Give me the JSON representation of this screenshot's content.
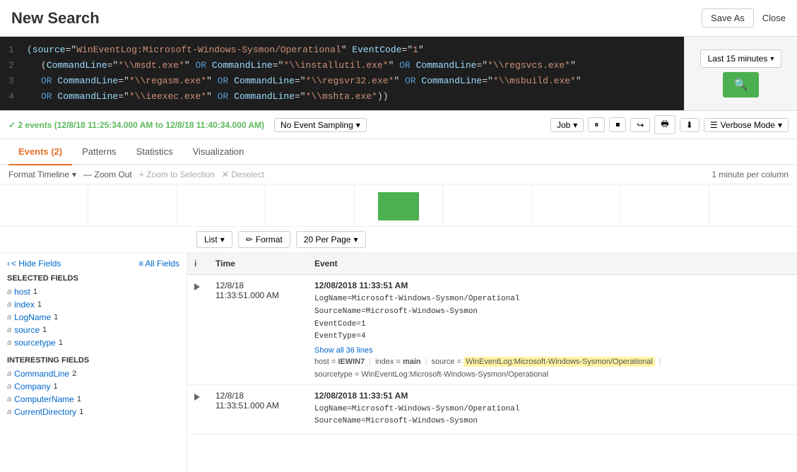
{
  "header": {
    "title": "New Search",
    "save_as_label": "Save As",
    "close_label": "Close"
  },
  "search": {
    "code_lines": [
      {
        "num": "1",
        "content": "(source=\"WinEventLog:Microsoft-Windows-Sysmon/Operational\" EventCode=\"1\""
      },
      {
        "num": "2",
        "content": "    (CommandLine=\"*\\\\msdt.exe*\" OR CommandLine=\"*\\\\installutil.exe*\" OR CommandLine=\"*\\\\regsvcs.exe*\""
      },
      {
        "num": "3",
        "content": "    OR CommandLine=\"*\\\\regasm.exe*\" OR CommandLine=\"*\\\\regsvr32.exe*\" OR CommandLine=\"*\\\\msbuild.exe*\""
      },
      {
        "num": "4",
        "content": "    OR CommandLine=\"*\\\\ieexec.exe*\" OR CommandLine=\"*\\\\mshta.exe*\"))"
      }
    ],
    "time_range": "Last 15 minutes"
  },
  "toolbar": {
    "result_count": "✓ 2 events (12/8/18 11:25:34.000 AM to 12/8/18 11:40:34.000 AM)",
    "sampling_label": "No Event Sampling",
    "job_label": "Job",
    "verbose_label": "Verbose Mode"
  },
  "tabs": [
    {
      "label": "Events (2)",
      "active": true
    },
    {
      "label": "Patterns",
      "active": false
    },
    {
      "label": "Statistics",
      "active": false
    },
    {
      "label": "Visualization",
      "active": false
    }
  ],
  "timeline": {
    "format_btn": "Format Timeline",
    "zoom_out_btn": "— Zoom Out",
    "zoom_selection_btn": "+ Zoom to Selection",
    "deselect_btn": "✕ Deselect",
    "per_column": "1 minute per column"
  },
  "results_toolbar": {
    "list_btn": "List",
    "format_btn": "Format",
    "per_page_btn": "20 Per Page"
  },
  "sidebar": {
    "hide_fields_btn": "< Hide Fields",
    "all_fields_btn": "≡ All Fields",
    "selected_section": "SELECTED FIELDS",
    "selected_fields": [
      {
        "type": "a",
        "name": "host",
        "count": "1"
      },
      {
        "type": "a",
        "name": "index",
        "count": "1"
      },
      {
        "type": "a",
        "name": "LogName",
        "count": "1"
      },
      {
        "type": "a",
        "name": "source",
        "count": "1"
      },
      {
        "type": "a",
        "name": "sourcetype",
        "count": "1"
      }
    ],
    "interesting_section": "INTERESTING FIELDS",
    "interesting_fields": [
      {
        "type": "a",
        "name": "CommandLine",
        "count": "2"
      },
      {
        "type": "a",
        "name": "Company",
        "count": "1"
      },
      {
        "type": "a",
        "name": "ComputerName",
        "count": "1"
      },
      {
        "type": "a",
        "name": "CurrentDirectory",
        "count": "1"
      }
    ]
  },
  "table": {
    "headers": [
      "",
      "Time",
      "Event"
    ],
    "rows": [
      {
        "time": "12/8/18\n11:33:51.000 AM",
        "timestamp": "12/08/2018 11:33:51 AM",
        "details": [
          "LogName=Microsoft-Windows-Sysmon/Operational",
          "SourceName=Microsoft-Windows-Sysmon",
          "EventCode=1",
          "EventType=4"
        ],
        "show_more": "Show all 36 lines",
        "tags": [
          {
            "label": "host =  IEWIN7",
            "highlighted": false
          },
          {
            "label": "index =  main",
            "highlighted": false
          },
          {
            "label": "source =  WinEventLog:Microsoft-Windows-Sysmon/Operational",
            "highlighted": true
          },
          {
            "label": "sourcetype =  WinEventLog:Microsoft-Windows-Sysmon/Operational",
            "highlighted": false
          }
        ]
      },
      {
        "time": "12/8/18\n11:33:51.000 AM",
        "timestamp": "12/08/2018 11:33:51 AM",
        "details": [
          "LogName=Microsoft-Windows-Sysmon/Operational",
          "SourceName=Microsoft-Windows-Sysmon"
        ],
        "show_more": "",
        "tags": []
      }
    ]
  },
  "colors": {
    "accent_orange": "#e8702a",
    "accent_green": "#4caf50",
    "link_blue": "#0066cc",
    "highlight_yellow": "#fff3a3"
  }
}
